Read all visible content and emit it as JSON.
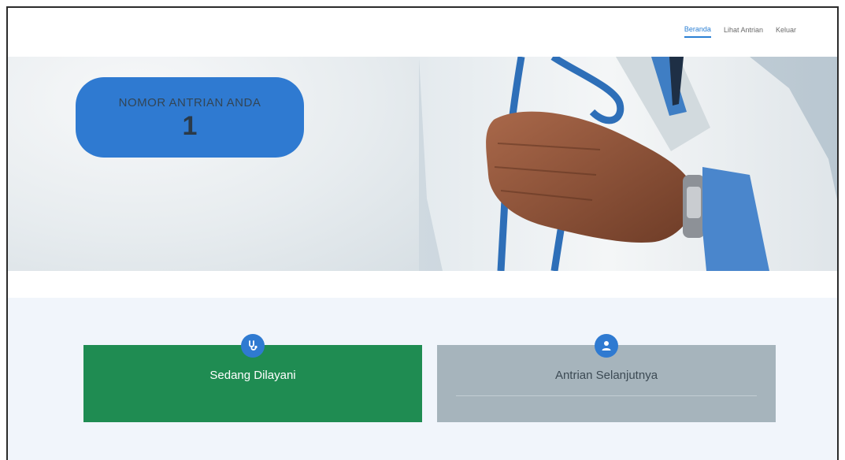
{
  "nav": {
    "items": [
      {
        "label": "Beranda",
        "active": true
      },
      {
        "label": "Lihat Antrian",
        "active": false
      },
      {
        "label": "Keluar",
        "active": false
      }
    ]
  },
  "hero": {
    "badge_title": "NOMOR ANTRIAN ANDA",
    "badge_number": "1",
    "image": "doctor-with-stethoscope-photo"
  },
  "cards": {
    "serving": {
      "title": "Sedang Dilayani",
      "icon": "stethoscope-icon",
      "color": "#1f8c52"
    },
    "next": {
      "title": "Antrian Selanjutnya",
      "icon": "user-icon",
      "color": "#a6b4bc"
    }
  },
  "colors": {
    "accent": "#2f7ad1",
    "green": "#1f8c52",
    "gray_card": "#a6b4bc",
    "section_bg": "#f1f5fb"
  }
}
